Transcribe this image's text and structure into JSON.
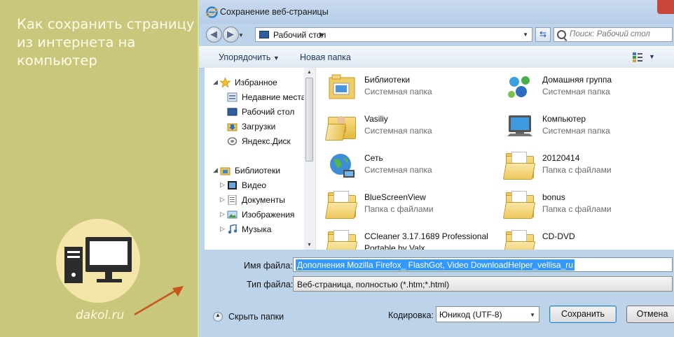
{
  "banner": {
    "headline": "Как сохранить страницу из интернета на компьютер",
    "site": "dakol.ru"
  },
  "dialog": {
    "title": "Сохранение веб-страницы",
    "address": {
      "location": "Рабочий стол"
    },
    "search": {
      "placeholder": "Поиск: Рабочий стол"
    },
    "toolbar": {
      "organize": "Упорядочить",
      "new_folder": "Новая папка"
    },
    "nav": {
      "favorites": "Избранное",
      "items": [
        "Недавние места",
        "Рабочий стол",
        "Загрузки",
        "Яндекс.Диск"
      ],
      "libraries": "Библиотеки",
      "lib_items": [
        "Видео",
        "Документы",
        "Изображения",
        "Музыка"
      ]
    },
    "files": [
      {
        "name": "Библиотеки",
        "type": "Системная папка",
        "icon": "libraries-icon"
      },
      {
        "name": "Домашняя группа",
        "type": "Системная папка",
        "icon": "homegroup-icon"
      },
      {
        "name": "Vasiliy",
        "type": "Системная папка",
        "icon": "user-folder-icon"
      },
      {
        "name": "Компьютер",
        "type": "Системная папка",
        "icon": "computer-icon"
      },
      {
        "name": "Сеть",
        "type": "Системная папка",
        "icon": "network-icon"
      },
      {
        "name": "20120414",
        "type": "Папка с файлами",
        "icon": "folder-icon"
      },
      {
        "name": "BlueScreenView",
        "type": "Папка с файлами",
        "icon": "folder-icon"
      },
      {
        "name": "bonus",
        "type": "Папка с файлами",
        "icon": "folder-icon"
      },
      {
        "name": "CCleaner 3.17.1689 Professional",
        "type": "Portable by Valx",
        "icon": "folder-icon"
      },
      {
        "name": "CD-DVD",
        "type": "",
        "icon": "folder-icon"
      }
    ],
    "form": {
      "filename_label": "Имя файла:",
      "filename_value": "Дополнения Mozilla Firefox_ FlashGot, Video DownloadHelper_vellisa_ru",
      "filetype_label": "Тип файла:",
      "filetype_value": "Веб-страница, полностью (*.htm;*.html)",
      "hide_folders": "Скрыть папки",
      "encoding_label": "Кодировка:",
      "encoding_value": "Юникод (UTF-8)",
      "save": "Сохранить",
      "cancel": "Отмена"
    }
  },
  "colors": {
    "banner_bg": "#c8c77c",
    "dialog_bg": "#bcd3ea",
    "selection": "#3399ff",
    "arrow": "#c8571d"
  }
}
